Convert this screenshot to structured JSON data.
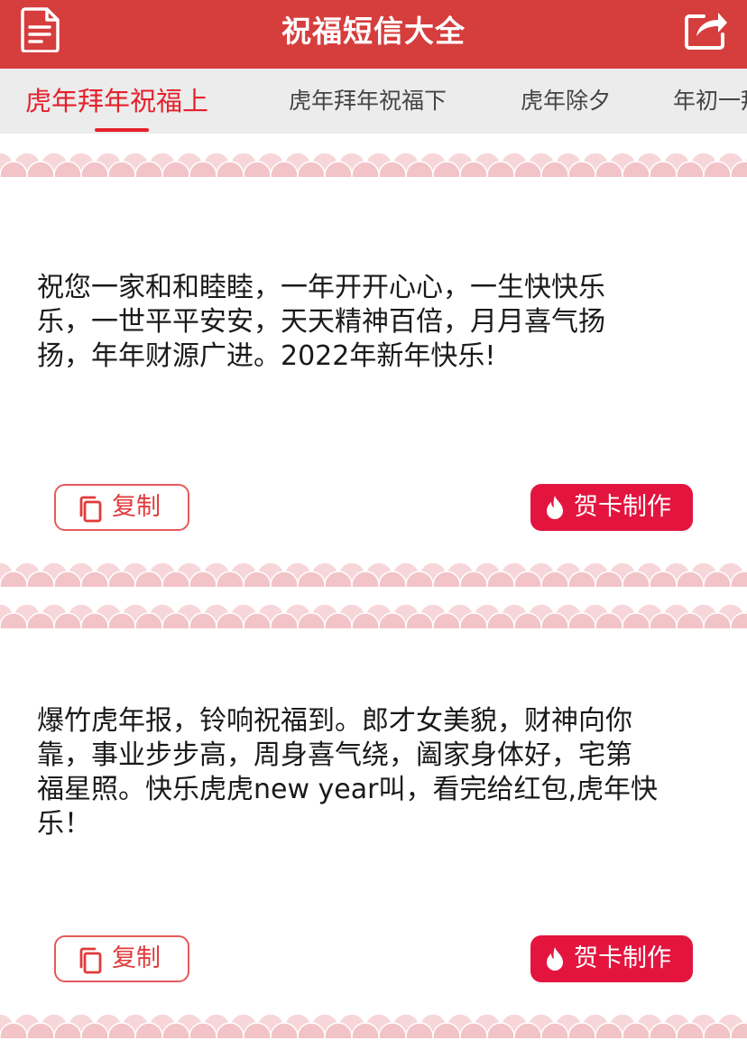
{
  "header": {
    "title": "祝福短信大全",
    "left_icon": "document-icon",
    "right_icon": "share-icon"
  },
  "tabs": [
    {
      "label": "虎年拜年祝福上",
      "active": true
    },
    {
      "label": "虎年拜年祝福下",
      "active": false
    },
    {
      "label": "虎年除夕",
      "active": false
    },
    {
      "label": "年初一拜",
      "active": false
    }
  ],
  "messages": [
    {
      "lines": [
        "祝您一家和和睦睦，一年开开心心，一生快快乐",
        "乐，一世平平安安，天天精神百倍，月月喜气扬",
        "扬，年年财源广进。2022年新年快乐!"
      ],
      "copy_label": "复制",
      "card_label": "贺卡制作"
    },
    {
      "lines": [
        "爆竹虎年报，铃响祝福到。郎才女美貌，财神向你",
        "靠，事业步步高，周身喜气绕，阖家身体好，宅第",
        "福星照。快乐虎虎new year叫，看完给红包,虎年快",
        "乐！"
      ],
      "copy_label": "复制",
      "card_label": "贺卡制作"
    }
  ],
  "colors": {
    "header_bg": "#d63d3d",
    "tab_active": "#e5212c",
    "card_button": "#e3153f",
    "wave": "#f2c4c8"
  },
  "icons": {
    "copy": "copy-icon",
    "card": "flame-icon"
  }
}
